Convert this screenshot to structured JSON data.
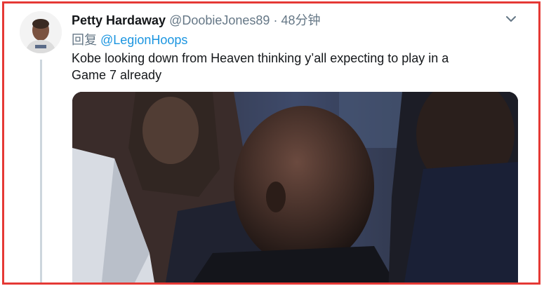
{
  "tweet": {
    "author_name": "Petty Hardaway",
    "author_handle": "@DoobieJones89",
    "separator": "·",
    "time": "48分钟",
    "reply_prefix": "回复",
    "reply_to": "@LegionHoops",
    "text_line1": "Kobe looking down from Heaven thinking y’all expecting to play in a",
    "text_line2": "Game 7 already"
  },
  "icons": {
    "menu": "chevron-down-icon",
    "avatar": "profile-photo",
    "media": "video-still"
  },
  "colors": {
    "border_highlight": "#e53935",
    "name": "#14171a",
    "muted": "#657786",
    "link": "#1b95e0",
    "thread_line": "#cdd6dd"
  }
}
